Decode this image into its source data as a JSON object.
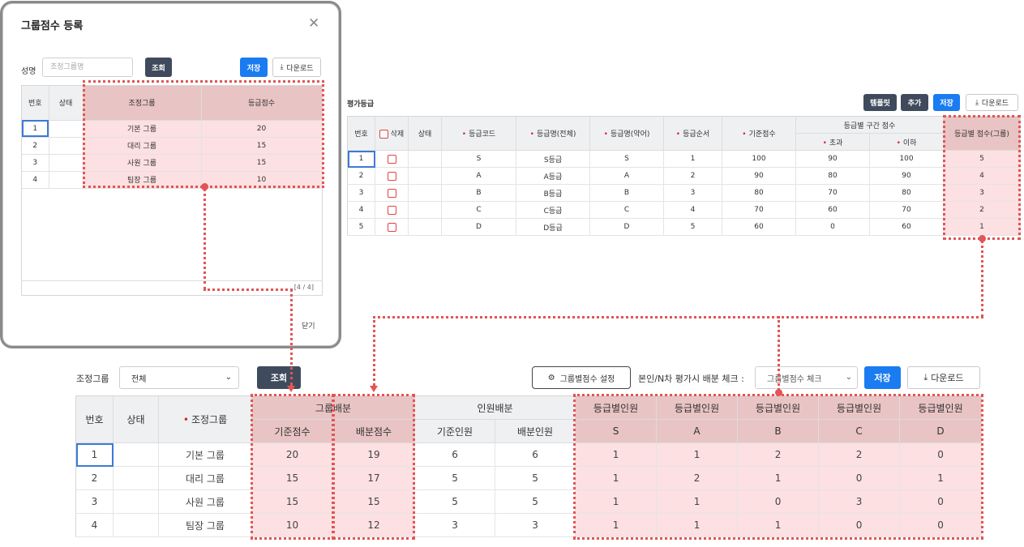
{
  "modal": {
    "title": "그룹점수 등록",
    "close_icon": "✕",
    "search_label": "성명",
    "search_placeholder": "조정그룹명",
    "search_button": "조회",
    "save_button": "저장",
    "download_button": "다운로드",
    "columns": [
      "번호",
      "상태",
      "조정그룹",
      "등급점수"
    ],
    "rows": [
      {
        "no": "1",
        "status": "",
        "group": "기본 그룹",
        "score": "20"
      },
      {
        "no": "2",
        "status": "",
        "group": "대리 그룹",
        "score": "15"
      },
      {
        "no": "3",
        "status": "",
        "group": "사원 그룹",
        "score": "15"
      },
      {
        "no": "4",
        "status": "",
        "group": "팀장 그룹",
        "score": "10"
      }
    ],
    "record_count": "[4 / 4]",
    "close_text": "닫기"
  },
  "grade": {
    "title": "평가등급",
    "buttons": {
      "template": "템플릿",
      "add": "추가",
      "save": "저장",
      "download": "다운로드"
    },
    "columns": {
      "no": "번호",
      "delete": "삭제",
      "status": "상태",
      "code": "등급코드",
      "name_full": "등급명(전체)",
      "name_short": "등급명(약어)",
      "order": "등급순서",
      "base_score": "기준점수",
      "range": "등급별 구간 점수",
      "over": "초과",
      "under": "이하",
      "group_score": "등급별 점수(그룹)"
    },
    "rows": [
      {
        "no": "1",
        "code": "S",
        "name_full": "S등급",
        "name_short": "S",
        "order": "1",
        "base": "100",
        "over": "90",
        "under": "100",
        "gscore": "5"
      },
      {
        "no": "2",
        "code": "A",
        "name_full": "A등급",
        "name_short": "A",
        "order": "2",
        "base": "90",
        "over": "80",
        "under": "90",
        "gscore": "4"
      },
      {
        "no": "3",
        "code": "B",
        "name_full": "B등급",
        "name_short": "B",
        "order": "3",
        "base": "80",
        "over": "70",
        "under": "80",
        "gscore": "3"
      },
      {
        "no": "4",
        "code": "C",
        "name_full": "C등급",
        "name_short": "C",
        "order": "4",
        "base": "70",
        "over": "60",
        "under": "70",
        "gscore": "2"
      },
      {
        "no": "5",
        "code": "D",
        "name_full": "D등급",
        "name_short": "D",
        "order": "5",
        "base": "60",
        "over": "0",
        "under": "60",
        "gscore": "1"
      }
    ]
  },
  "main": {
    "group_label": "조정그룹",
    "group_select_value": "전체",
    "search_button": "조회",
    "group_score_button": "그룹별점수 설정",
    "check_label": "본인/N차 평가시 배분 체크 :",
    "check_select_value": "그룹별점수 체크",
    "save_button": "저장",
    "download_button": "다운로드",
    "columns": {
      "no": "번호",
      "status": "상태",
      "group": "조정그룹",
      "group_alloc": "그룹배분",
      "base_score": "기준점수",
      "alloc_score": "배분점수",
      "person_alloc": "인원배분",
      "base_person": "기준인원",
      "alloc_person": "배분인원",
      "grade_person": "등급별인원",
      "grades": [
        "S",
        "A",
        "B",
        "C",
        "D"
      ]
    },
    "rows": [
      {
        "no": "1",
        "group": "기본 그룹",
        "base_score": "20",
        "alloc_score": "19",
        "base_person": "6",
        "alloc_person": "6",
        "s": "1",
        "a": "1",
        "b": "2",
        "c": "2",
        "d": "0"
      },
      {
        "no": "2",
        "group": "대리 그룹",
        "base_score": "15",
        "alloc_score": "17",
        "base_person": "5",
        "alloc_person": "5",
        "s": "1",
        "a": "2",
        "b": "1",
        "c": "0",
        "d": "1"
      },
      {
        "no": "3",
        "group": "사원 그룹",
        "base_score": "15",
        "alloc_score": "15",
        "base_person": "5",
        "alloc_person": "5",
        "s": "1",
        "a": "1",
        "b": "0",
        "c": "3",
        "d": "0"
      },
      {
        "no": "4",
        "group": "팀장 그룹",
        "base_score": "10",
        "alloc_score": "12",
        "base_person": "3",
        "alloc_person": "3",
        "s": "1",
        "a": "1",
        "b": "1",
        "c": "0",
        "d": "0"
      }
    ]
  },
  "colors": {
    "accent": "#1a7cf0",
    "dark_button": "#3f4b5d",
    "highlight": "#e35454",
    "highlight_fill": "#fde0e2",
    "alert_text": "#e02020"
  }
}
